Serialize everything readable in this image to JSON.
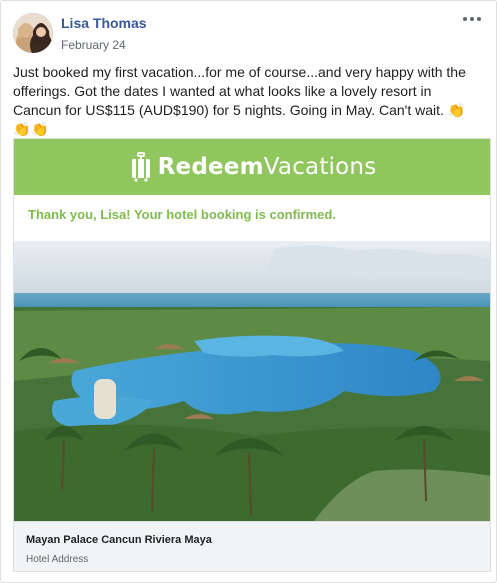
{
  "post": {
    "author": "Lisa Thomas",
    "date": "February 24",
    "text": "Just booked my first vacation...for me of course...and very happy with the offerings. Got the dates I wanted at what looks like a lovely resort in Cancun for US$115 (AUD$190) for 5 nights. Going in May. Can't wait.",
    "emoji": "👏👏👏",
    "more_icon": "more-options-icon"
  },
  "card": {
    "brand_part1": "Redeem",
    "brand_part2": "Vacations",
    "brand_icon": "suitcase-icon",
    "confirmation": "Thank you, Lisa! Your hotel booking is confirmed.",
    "hotel_name": "Mayan Palace Cancun Riviera Maya",
    "hotel_address": "Hotel Address"
  },
  "colors": {
    "link": "#385898",
    "brand_green": "#8fc65d",
    "confirm_green": "#7fbc4d",
    "caption_bg": "#f2f3f5"
  }
}
